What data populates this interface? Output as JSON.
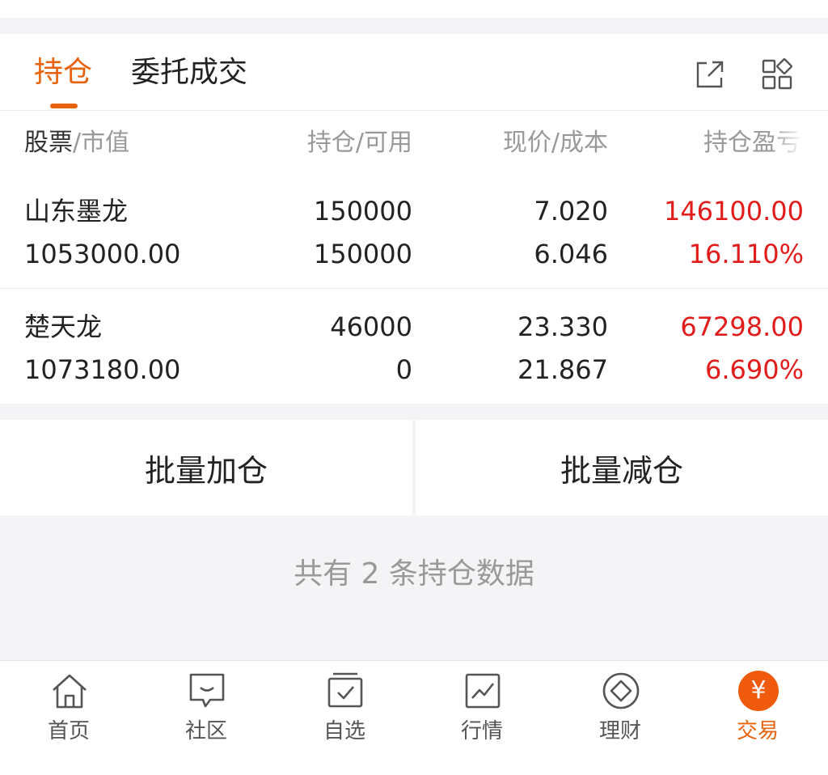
{
  "tabs": [
    {
      "label": "持仓",
      "active": true
    },
    {
      "label": "委托成交",
      "active": false
    }
  ],
  "header_icons": [
    "share-icon",
    "grid-icon"
  ],
  "columns": {
    "col1_main": "股票",
    "col1_sep": "/",
    "col1_sub": "市值",
    "col2": "持仓/可用",
    "col3": "现价/成本",
    "col4": "持仓盈亏"
  },
  "holdings": [
    {
      "name": "山东墨龙",
      "market_value": "1053000.00",
      "position": "150000",
      "available": "150000",
      "price": "7.020",
      "cost": "6.046",
      "pnl": "146100.00",
      "pnl_pct": "16.110%"
    },
    {
      "name": "楚天龙",
      "market_value": "1073180.00",
      "position": "46000",
      "available": "0",
      "price": "23.330",
      "cost": "21.867",
      "pnl": "67298.00",
      "pnl_pct": "6.690%"
    }
  ],
  "actions": {
    "batch_add": "批量加仓",
    "batch_reduce": "批量减仓"
  },
  "summary": "共有 2 条持仓数据",
  "nav": [
    {
      "label": "首页",
      "icon": "home-icon"
    },
    {
      "label": "社区",
      "icon": "chat-icon"
    },
    {
      "label": "自选",
      "icon": "watchlist-icon"
    },
    {
      "label": "行情",
      "icon": "chart-icon"
    },
    {
      "label": "理财",
      "icon": "diamond-icon"
    },
    {
      "label": "交易",
      "icon": "yuan-icon",
      "glyph": "¥",
      "active": true
    }
  ],
  "colors": {
    "accent": "#e8620c",
    "profit": "#e21b1b"
  }
}
